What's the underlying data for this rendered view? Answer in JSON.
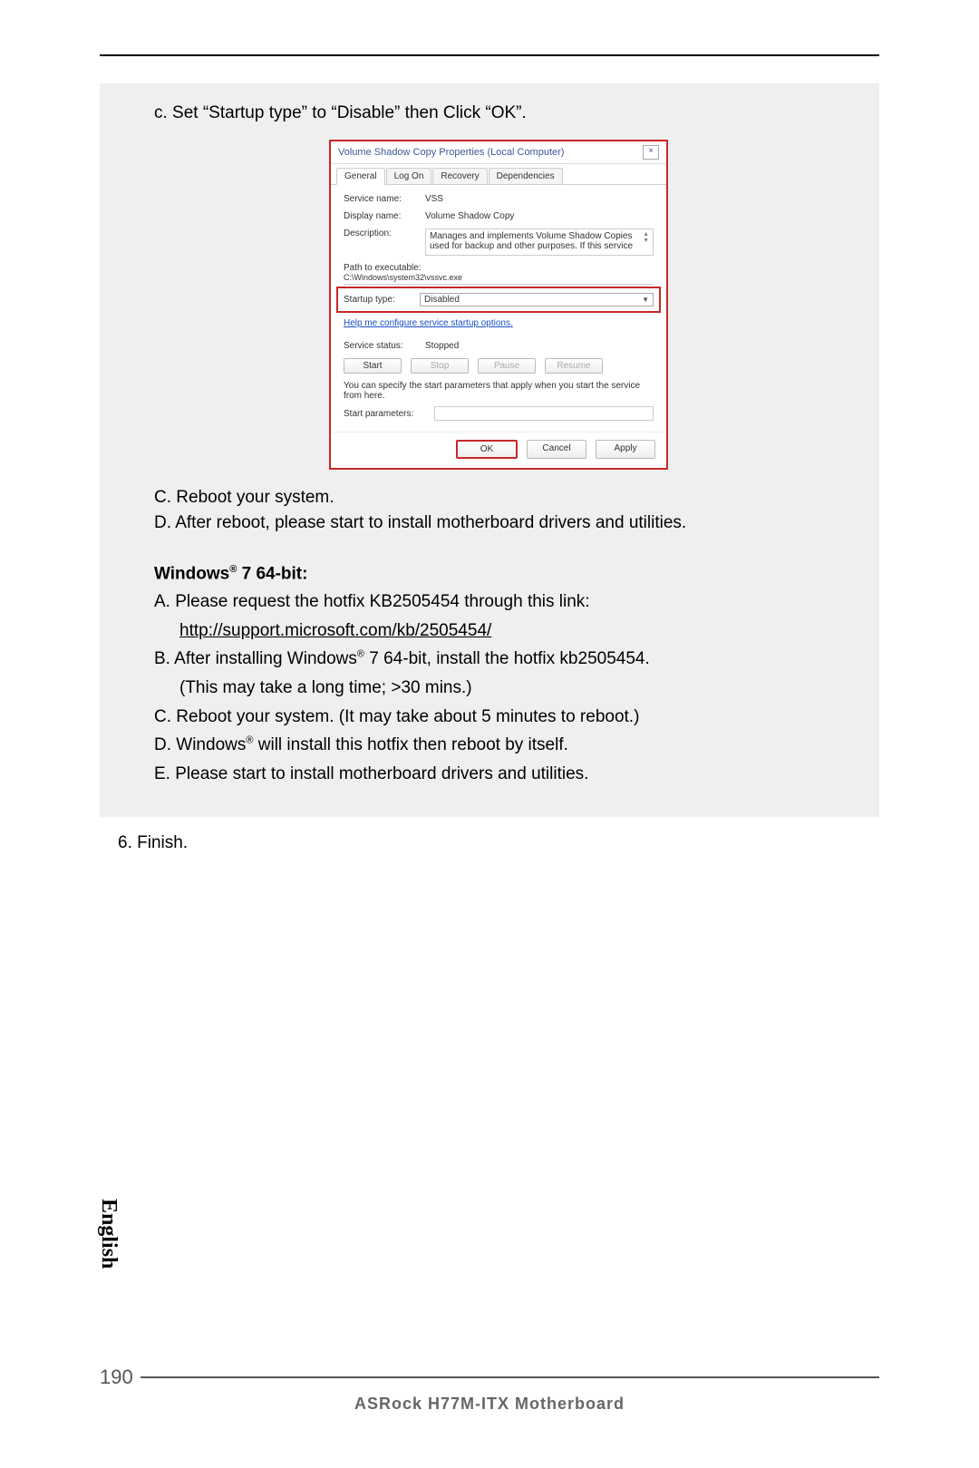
{
  "page": {
    "step_c_top": "c. Set “Startup type” to “Disable” then Click “OK”.",
    "english_tab": "English",
    "page_number": "190",
    "footer_title": "ASRock  H77M-ITX  Motherboard",
    "finish_line": "6. Finish."
  },
  "dialog": {
    "title": "Volume Shadow Copy Properties (Local Computer)",
    "close": "×",
    "tabs": {
      "general": "General",
      "logon": "Log On",
      "recovery": "Recovery",
      "dependencies": "Dependencies"
    },
    "service_name_label": "Service name:",
    "service_name_value": "VSS",
    "display_name_label": "Display name:",
    "display_name_value": "Volume Shadow Copy",
    "description_label": "Description:",
    "description_value": "Manages and implements Volume Shadow Copies used for backup and other purposes. If this service",
    "path_label": "Path to executable:",
    "path_value": "C:\\Windows\\system32\\vssvc.exe",
    "startup_type_label": "Startup type:",
    "startup_type_value": "Disabled",
    "help_link": "Help me configure service startup options.",
    "service_status_label": "Service status:",
    "service_status_value": "Stopped",
    "btn_start": "Start",
    "btn_stop": "Stop",
    "btn_pause": "Pause",
    "btn_resume": "Resume",
    "note": "You can specify the start parameters that apply when you start the service from here.",
    "start_params_label": "Start parameters:",
    "btn_ok": "OK",
    "btn_cancel": "Cancel",
    "btn_apply": "Apply"
  },
  "after": {
    "line_c": "C. Reboot your system.",
    "line_d": "D. After reboot, please start to install motherboard drivers and utilities."
  },
  "win7": {
    "heading_prefix": "Windows",
    "heading_suffix": " 7 64-bit:",
    "a_line": "A. Please request the hotfix KB2505454 through this link:",
    "a_link": "http://support.microsoft.com/kb/2505454/",
    "b_prefix": "B. After installing Windows",
    "b_suffix": " 7 64-bit, install the hotfix kb2505454.",
    "b_note": "(This may take a long time; >30 mins.)",
    "c_line": "C. Reboot your system. (It may take about 5 minutes to reboot.)",
    "d_prefix": "D. Windows",
    "d_suffix": " will install this hotfix then reboot by itself.",
    "e_line": "E. Please start to install motherboard drivers and utilities."
  }
}
